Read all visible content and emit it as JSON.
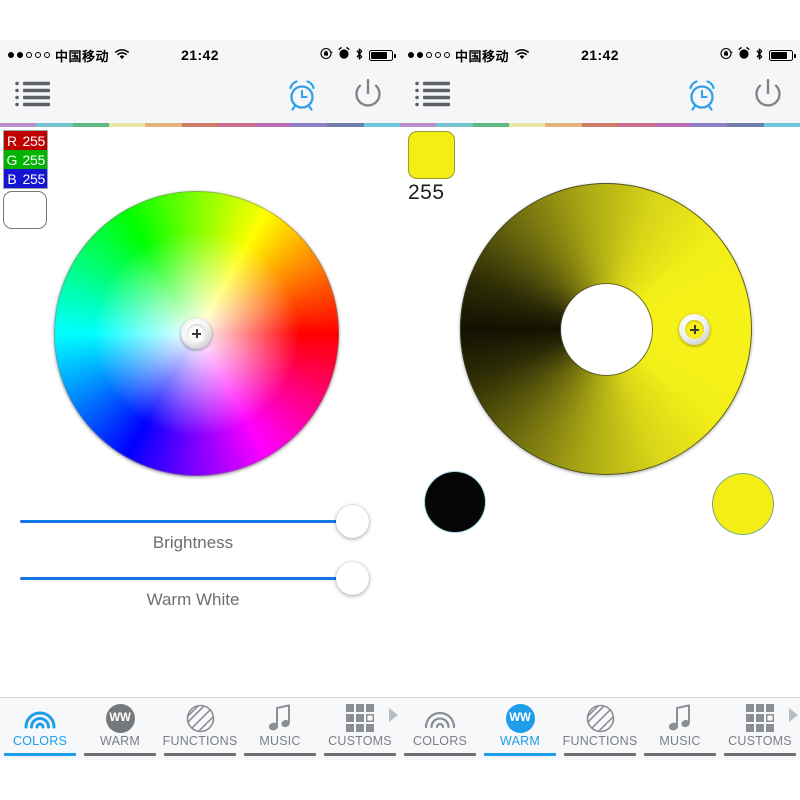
{
  "meta": {
    "accent_blue": "#1e9ee8",
    "slider_blue": "#1477e8",
    "panel_bg": "#f4f6f8",
    "tabbar_bg": "#f7f8f9",
    "selected_color_hex": "#ffffff",
    "warm_value_hex": "#f5ee14"
  },
  "color_strip": [
    "#b88ec4",
    "#74c5cd",
    "#5fb87f",
    "#e9e6a8",
    "#e3b277",
    "#cf7b6a",
    "#cf6f8f",
    "#b56fb0",
    "#8d7fc2",
    "#6d7fa8",
    "#6fc7d8"
  ],
  "left_phone": {
    "status_bar": {
      "signal_dots": [
        true,
        true,
        false,
        false,
        false
      ],
      "carrier": "中国移动",
      "wifi_icon": "wifi-icon",
      "time": "21:42",
      "icons": [
        "rotation-lock-icon",
        "alarm-icon",
        "bluetooth-icon",
        "battery-icon"
      ]
    },
    "navbar": {
      "menu_icon": "list-menu-icon",
      "timer_icon": "alarm-clock-icon",
      "power_icon": "power-icon"
    },
    "rgb_readout": {
      "rows": [
        {
          "channel": "R",
          "value": "255",
          "bg": "#c00000"
        },
        {
          "channel": "G",
          "value": "255",
          "bg": "#00b400"
        },
        {
          "channel": "B",
          "value": "255",
          "bg": "#1414d2"
        }
      ],
      "swatch_hex": "#ffffff"
    },
    "color_wheel": {
      "name": "hsv-color-wheel",
      "selector_position": "center",
      "selected_hex": "#ffffff"
    },
    "sliders": [
      {
        "label": "Brightness",
        "value": 100,
        "max": 100
      },
      {
        "label": "Warm White",
        "value": 100,
        "max": 100
      }
    ],
    "tabs": [
      {
        "label": "COLORS",
        "icon": "rainbow-icon",
        "active": true
      },
      {
        "label": "WARM",
        "icon": "ww-icon",
        "active": false
      },
      {
        "label": "FUNCTIONS",
        "icon": "striped-ball-icon",
        "active": false
      },
      {
        "label": "MUSIC",
        "icon": "music-note-icon",
        "active": false
      },
      {
        "label": "CUSTOMS",
        "icon": "grid-icon",
        "active": false
      }
    ]
  },
  "right_phone": {
    "status_bar": {
      "signal_dots": [
        true,
        true,
        false,
        false,
        false
      ],
      "carrier": "中国移动",
      "wifi_icon": "wifi-icon",
      "time": "21:42",
      "icons": [
        "rotation-lock-icon",
        "alarm-icon",
        "bluetooth-icon",
        "battery-icon"
      ]
    },
    "navbar": {
      "menu_icon": "list-menu-icon",
      "timer_icon": "alarm-clock-icon",
      "power_icon": "power-icon"
    },
    "value_swatch": {
      "hex": "#f5ee14",
      "label": "255"
    },
    "brightness_wheel": {
      "name": "warm-white-brightness-wheel",
      "min_hex": "#121202",
      "max_hex": "#f7f319",
      "selector_side": "right"
    },
    "endpoints": [
      {
        "name": "minimum-swatch",
        "hex": "#050505"
      },
      {
        "name": "maximum-swatch",
        "hex": "#f5ee14"
      }
    ],
    "tabs": [
      {
        "label": "COLORS",
        "icon": "rainbow-icon",
        "active": false
      },
      {
        "label": "WARM",
        "icon": "ww-icon",
        "active": true
      },
      {
        "label": "FUNCTIONS",
        "icon": "striped-ball-icon",
        "active": false
      },
      {
        "label": "MUSIC",
        "icon": "music-note-icon",
        "active": false
      },
      {
        "label": "CUSTOMS",
        "icon": "grid-icon",
        "active": false
      }
    ]
  }
}
